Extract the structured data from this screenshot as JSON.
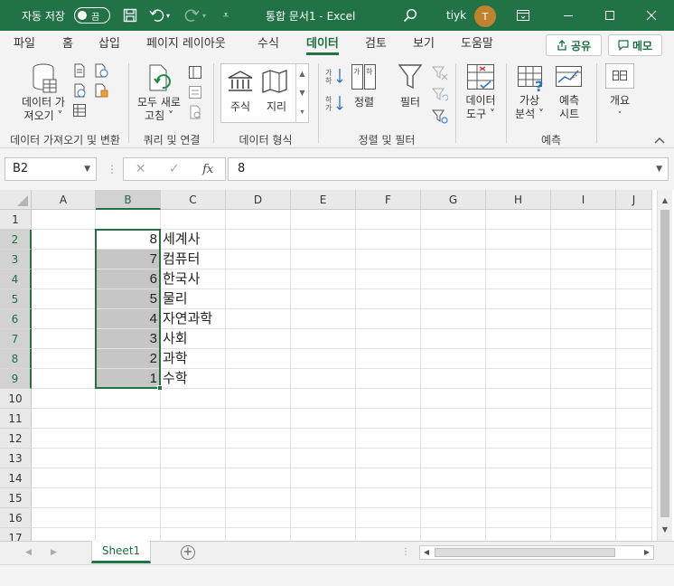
{
  "titlebar": {
    "autosave_label": "자동 저장",
    "autosave_state": "끔",
    "doc_title": "통합 문서1  -  Excel",
    "user_name": "tiyk",
    "avatar_initial": "T",
    "icons": [
      "save-icon",
      "undo-icon",
      "redo-icon",
      "customize-icon",
      "search-icon",
      "ribbon-display-icon",
      "minimize-icon",
      "maximize-icon",
      "close-icon"
    ]
  },
  "ribbon_tabs": [
    "파일",
    "홈",
    "삽입",
    "페이지 레이아웃",
    "수식",
    "데이터",
    "검토",
    "보기",
    "도움말"
  ],
  "active_tab": "데이터",
  "share_label": "공유",
  "memo_label": "메모",
  "ribbon": {
    "get_data_label": "데이터 가\n져오기 ˅",
    "refresh_all_label": "모두 새로\n고침 ˅",
    "stocks_label": "주식",
    "geography_label": "지리",
    "sort_label": "정렬",
    "filter_label": "필터",
    "data_tools_label": "데이터\n도구 ˅",
    "whatif_label": "가상\n분석 ˅",
    "forecast_label": "예측\n시트",
    "outline_label": "개요",
    "group_labels": {
      "get_transform": "데이터 가져오기 및 변환",
      "queries": "쿼리 및 연결",
      "data_types": "데이터 형식",
      "sort_filter": "정렬 및 필터",
      "forecast": "예측"
    }
  },
  "formula_bar": {
    "name_box": "B2",
    "cancel": "✕",
    "enter": "✓",
    "fx": "fx",
    "value": "8"
  },
  "columns": [
    "A",
    "B",
    "C",
    "D",
    "E",
    "F",
    "G",
    "H",
    "I",
    "J"
  ],
  "rows": [
    "1",
    "2",
    "3",
    "4",
    "5",
    "6",
    "7",
    "8",
    "9",
    "10",
    "11",
    "12",
    "13",
    "14",
    "15",
    "16",
    "17"
  ],
  "cells": {
    "B2": "8",
    "C2": "세계사",
    "B3": "7",
    "C3": "컴퓨터",
    "B4": "6",
    "C4": "한국사",
    "B5": "5",
    "C5": "물리",
    "B6": "4",
    "C6": "자연과학",
    "B7": "3",
    "C7": "사회",
    "B8": "2",
    "C8": "과학",
    "B9": "1",
    "C9": "수학"
  },
  "active_cell": "B2",
  "selection": "B2:B9",
  "sheet_tab": "Sheet1",
  "add_sheet": "+"
}
